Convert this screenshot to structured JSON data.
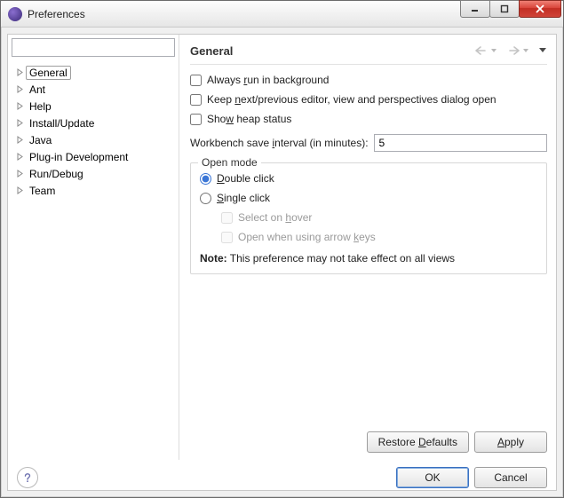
{
  "window": {
    "title": "Preferences"
  },
  "sidebar": {
    "filter_placeholder": "",
    "items": [
      {
        "label": "General",
        "selected": true
      },
      {
        "label": "Ant"
      },
      {
        "label": "Help"
      },
      {
        "label": "Install/Update"
      },
      {
        "label": "Java"
      },
      {
        "label": "Plug-in Development"
      },
      {
        "label": "Run/Debug"
      },
      {
        "label": "Team"
      }
    ]
  },
  "content": {
    "title": "General",
    "chk_bg": "Always run in background",
    "chk_keep": "Keep next/previous editor, view and perspectives dialog open",
    "chk_heap": "Show heap status",
    "save_interval_label": "Workbench save interval (in minutes):",
    "save_interval_value": "5",
    "open_mode": {
      "title": "Open mode",
      "double": "Double click",
      "single": "Single click",
      "hover": "Select on hover",
      "arrow": "Open when using arrow keys",
      "note_label": "Note:",
      "note_text": "This preference may not take effect on all views"
    }
  },
  "buttons": {
    "restore": "Restore Defaults",
    "apply": "Apply",
    "ok": "OK",
    "cancel": "Cancel"
  },
  "mnemonics": {
    "chk_bg": "r",
    "chk_keep": "n",
    "chk_heap": "w",
    "save_interval_label": "i",
    "double": "D",
    "single": "S",
    "hover": "h",
    "arrow": "k",
    "restore": "D",
    "apply": "A"
  }
}
